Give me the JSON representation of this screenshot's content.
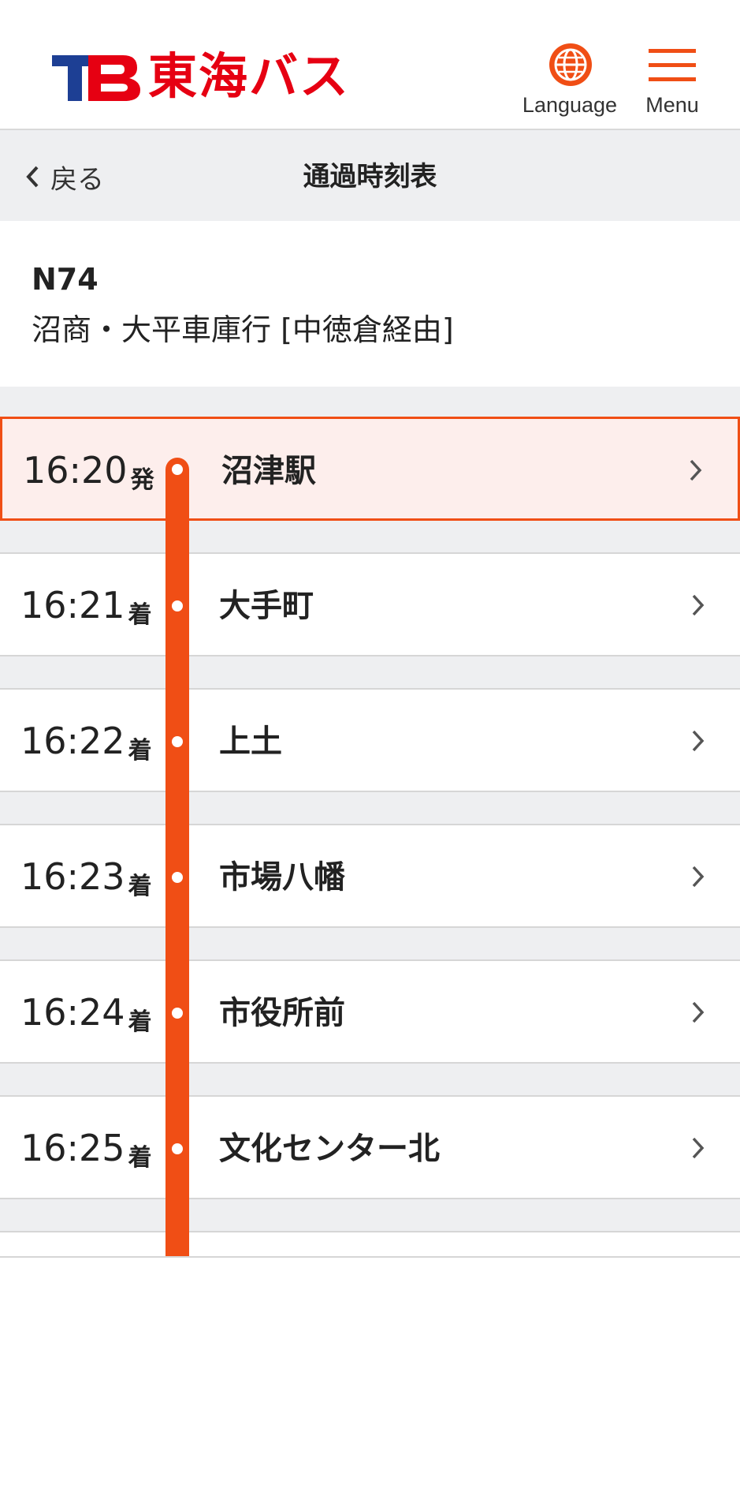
{
  "header": {
    "logo_text": "東海バス",
    "language_label": "Language",
    "menu_label": "Menu"
  },
  "subheader": {
    "back_label": "戻る",
    "title": "通過時刻表"
  },
  "route": {
    "number": "N74",
    "destination": "沼商・大平車庫行 [中徳倉経由]"
  },
  "stops": [
    {
      "time": "16:20",
      "kind": "発",
      "name": "沼津駅",
      "current": true
    },
    {
      "time": "16:21",
      "kind": "着",
      "name": "大手町",
      "current": false
    },
    {
      "time": "16:22",
      "kind": "着",
      "name": "上土",
      "current": false
    },
    {
      "time": "16:23",
      "kind": "着",
      "name": "市場八幡",
      "current": false
    },
    {
      "time": "16:24",
      "kind": "着",
      "name": "市役所前",
      "current": false
    },
    {
      "time": "16:25",
      "kind": "着",
      "name": "文化センター北",
      "current": false
    }
  ],
  "colors": {
    "accent": "#f04e15",
    "brand_red": "#e60012",
    "brand_blue": "#1d3f94",
    "current_bg": "#fdeeec"
  }
}
